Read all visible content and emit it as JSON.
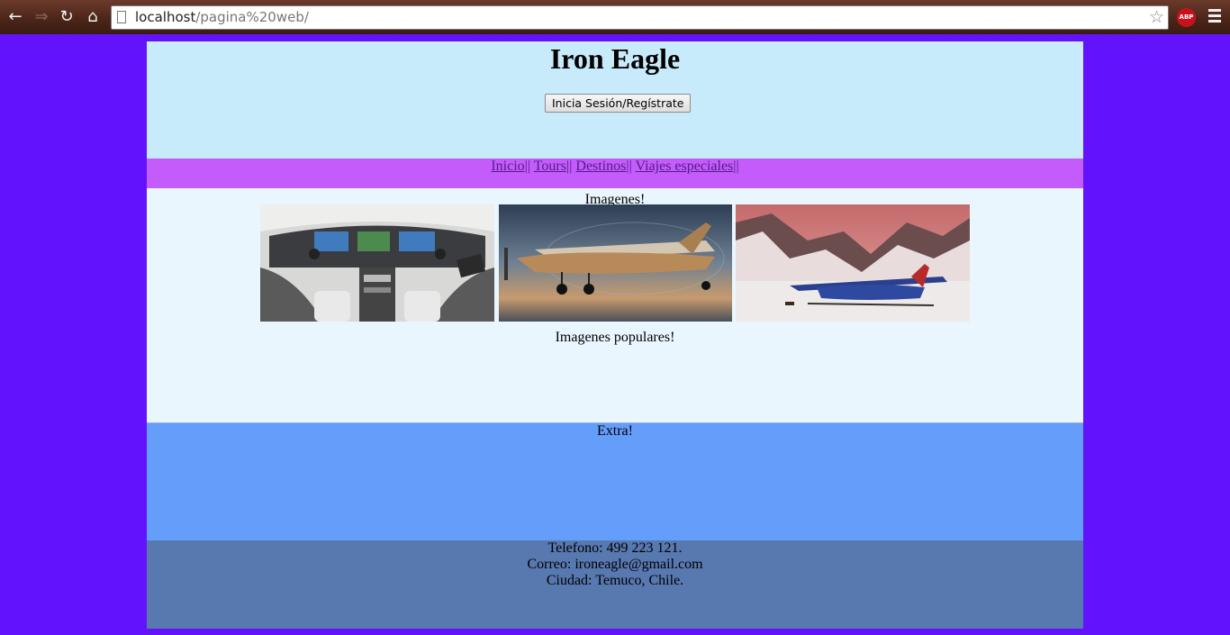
{
  "browser": {
    "url_host": "localhost",
    "url_path": "/pagina%20web/",
    "extension_badge": "ABP"
  },
  "header": {
    "title": "Iron Eagle",
    "login_button": "Inicia Sesión/Regístrate"
  },
  "nav": {
    "items": [
      "Inicio",
      "Tours",
      "Destinos",
      "Viajes especiales"
    ],
    "separator": "||"
  },
  "gallery": {
    "title": "Imagenes!",
    "popular_title": "Imagenes populares!"
  },
  "extra": {
    "title": "Extra!"
  },
  "footer": {
    "phone": "Telefono: 499 223 121.",
    "email": "Correo: ironeagle@gmail.com",
    "city": "Ciudad: Temuco, Chile."
  },
  "colors": {
    "page_background": "#6313fb",
    "header": "#c8ebfc",
    "nav": "#c45cfb",
    "gallery": "#eaf6fe",
    "extra": "#659dfb",
    "footer": "#5878b0"
  }
}
